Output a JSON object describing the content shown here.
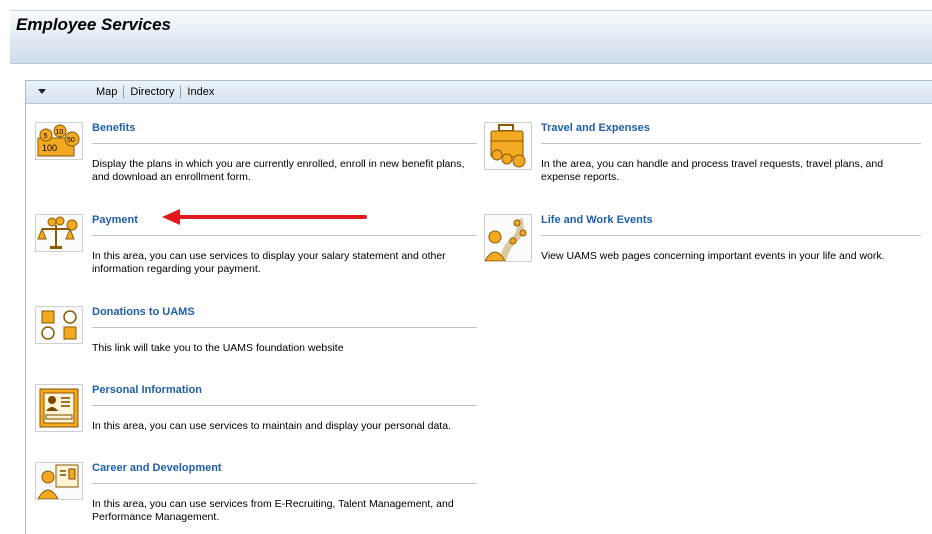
{
  "page": {
    "title": "Employee Services"
  },
  "tray": {
    "tabs": [
      "Map",
      "Directory",
      "Index"
    ]
  },
  "services": {
    "benefits": {
      "title": "Benefits",
      "desc": "Display the plans in which you are currently enrolled, enroll in new benefit plans, and download an enrollment form.",
      "icon": "benefits-coins-icon"
    },
    "payment": {
      "title": "Payment",
      "desc": "In this area, you can use services to display your salary statement and other information regarding your payment.",
      "icon": "payment-scale-icon"
    },
    "donations": {
      "title": "Donations to UAMS",
      "desc": "This link will take you to the UAMS foundation website",
      "icon": "donations-shapes-icon"
    },
    "personal": {
      "title": "Personal Information",
      "desc": "In this area, you can use services to maintain and display your personal data.",
      "icon": "id-card-icon"
    },
    "career": {
      "title": "Career and Development",
      "desc": "In this area, you can use services from E-Recruiting, Talent Management, and Performance Management.",
      "icon": "career-person-icon"
    },
    "travel": {
      "title": "Travel and Expenses",
      "desc": "In the area, you can handle and process travel requests, travel plans, and expense reports.",
      "icon": "suitcase-icon"
    },
    "life": {
      "title": "Life and Work Events",
      "desc": "View UAMS web pages concerning important events in your life and work.",
      "icon": "life-events-icon"
    }
  },
  "colors": {
    "link": "#1f5fa8",
    "annotation_arrow": "#e0191e",
    "icon_orange": "#f4a923"
  },
  "icon_text": {
    "coin_5": "5",
    "coin_10": "10",
    "coin_50": "50",
    "bill_100": "100"
  }
}
